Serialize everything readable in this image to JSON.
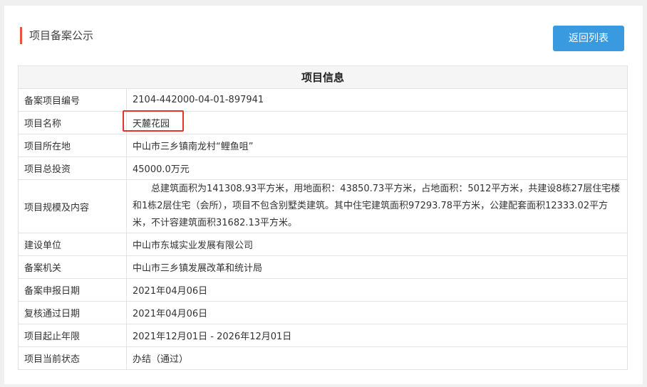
{
  "header": {
    "title": "项目备案公示",
    "back_label": "返回列表"
  },
  "table": {
    "heading": "项目信息",
    "rows": [
      {
        "label": "备案项目编号",
        "value": "2104-442000-04-01-897941"
      },
      {
        "label": "项目名称",
        "value": "天麓花园"
      },
      {
        "label": "项目所在地",
        "value": "中山市三乡镇南龙村“鲤鱼咀”"
      },
      {
        "label": "项目总投资",
        "value": "45000.0万元"
      },
      {
        "label": "项目规模及内容",
        "value": "　　总建筑面积为141308.93平方米，用地面积：43850.73平方米，占地面积：5012平方米，共建设8栋27层住宅楼和1栋2层住宅（会所），项目不包含别墅类建筑。其中住宅建筑面积97293.78平方米，公建配套面积12333.02平方米，不计容建筑面积31682.13平方米。"
      },
      {
        "label": "建设单位",
        "value": "中山市东城实业发展有限公司"
      },
      {
        "label": "备案机关",
        "value": "中山市三乡镇发展改革和统计局"
      },
      {
        "label": "备案申报日期",
        "value": "2021年04月06日"
      },
      {
        "label": "复核通过日期",
        "value": "2021年04月06日"
      },
      {
        "label": "项目起止年限",
        "value": "2021年12月01日 - 2026年12月01日"
      },
      {
        "label": "项目当前状态",
        "value": "办结（通过）"
      }
    ]
  },
  "colors": {
    "accent": "#3a9ae0",
    "title_marker": "#e8563f",
    "highlight": "#e8332a"
  }
}
